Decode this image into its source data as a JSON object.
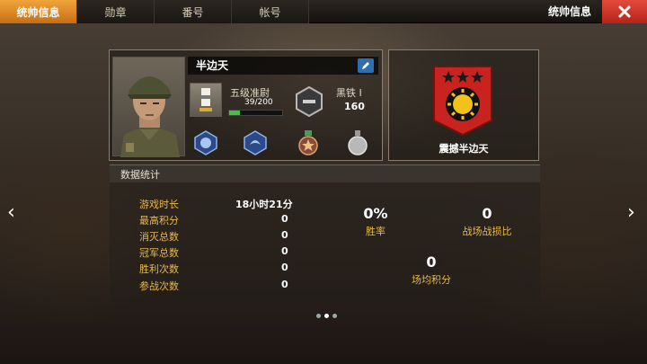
{
  "tabs": [
    {
      "label": "统帅信息",
      "active": true
    },
    {
      "label": "勋章",
      "active": false
    },
    {
      "label": "番号",
      "active": false
    },
    {
      "label": "帐号",
      "active": false
    }
  ],
  "header_title": "统帅信息",
  "profile": {
    "name": "半边天",
    "rank_title": "五级准尉",
    "xp_text": "39/200",
    "xp_fraction": 0.195,
    "tier_name": "黑铁 I",
    "tier_points": "160"
  },
  "unit": {
    "name": "震撼半边天"
  },
  "stats_header": "数据统计",
  "stats": [
    {
      "label": "游戏时长",
      "value": "18小时21分"
    },
    {
      "label": "最高积分",
      "value": "0"
    },
    {
      "label": "消灭总数",
      "value": "0"
    },
    {
      "label": "冠军总数",
      "value": "0"
    },
    {
      "label": "胜利次数",
      "value": "0"
    },
    {
      "label": "参战次数",
      "value": "0"
    }
  ],
  "summary": {
    "win_rate_value": "0%",
    "win_rate_label": "胜率",
    "kd_value": "0",
    "kd_label": "战场战损比",
    "avg_value": "0",
    "avg_label": "场均积分"
  },
  "page_dots": {
    "count": 3,
    "active": 1
  },
  "colors": {
    "tab_active": "#e8902a",
    "close": "#d43a2e",
    "stat_label": "#e8b848",
    "xp_fill": "#3fc43c"
  }
}
